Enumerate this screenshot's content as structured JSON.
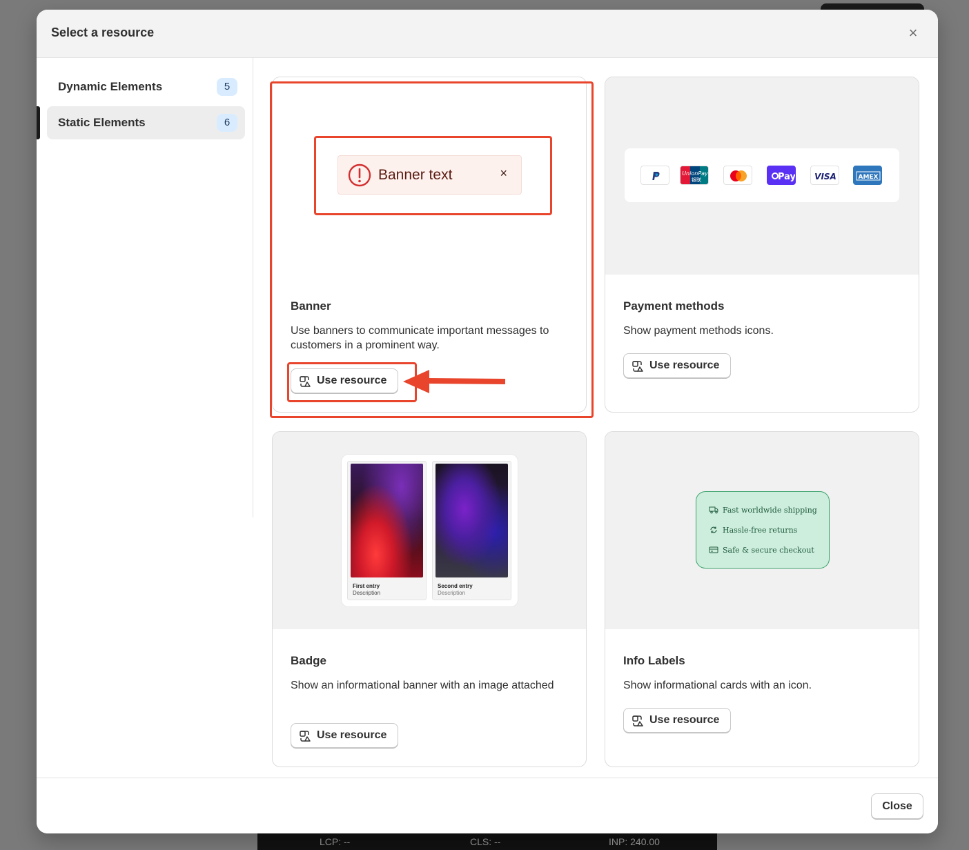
{
  "background": {
    "perf_bar": {
      "lcp": "LCP: --",
      "cls": "CLS: --",
      "inp": "INP: 240.00"
    }
  },
  "modal": {
    "title": "Select a resource",
    "close_icon": "close-icon",
    "footer": {
      "close_label": "Close"
    }
  },
  "sidebar": {
    "items": [
      {
        "label": "Dynamic Elements",
        "count": "5",
        "active": false
      },
      {
        "label": "Static Elements",
        "count": "6",
        "active": true
      }
    ]
  },
  "cards": [
    {
      "title": "Banner",
      "description": "Use banners to communicate important messages to customers in a prominent way.",
      "button_label": "Use resource",
      "preview": {
        "banner_text": "Banner text",
        "close_glyph": "×"
      }
    },
    {
      "title": "Payment methods",
      "description": "Show payment methods icons.",
      "button_label": "Use resource",
      "preview": {
        "methods": [
          "PayPal",
          "UnionPay",
          "Mastercard",
          "Shop Pay",
          "Visa",
          "Amex"
        ],
        "labels": {
          "unionpay": "UnionPay",
          "unionpay_cn": "银联",
          "shoppay": "Pay",
          "visa": "VISA",
          "amex": "AMEX"
        }
      }
    },
    {
      "title": "Badge",
      "description": "Show an informational banner with an image attached",
      "button_label": "Use resource",
      "preview": {
        "entries": [
          {
            "title": "First entry",
            "description": "Description"
          },
          {
            "title": "Second entry",
            "description": "Description"
          }
        ]
      }
    },
    {
      "title": "Info Labels",
      "description": "Show informational cards with an icon.",
      "button_label": "Use resource",
      "preview": {
        "rows": [
          "Fast worldwide shipping",
          "Hassle-free returns",
          "Safe & secure checkout"
        ]
      }
    }
  ],
  "colors": {
    "annotation": "#e8452c",
    "badge_bg": "#d9ecff",
    "info_bg": "#cdeedc",
    "info_border": "#3aa06a"
  }
}
